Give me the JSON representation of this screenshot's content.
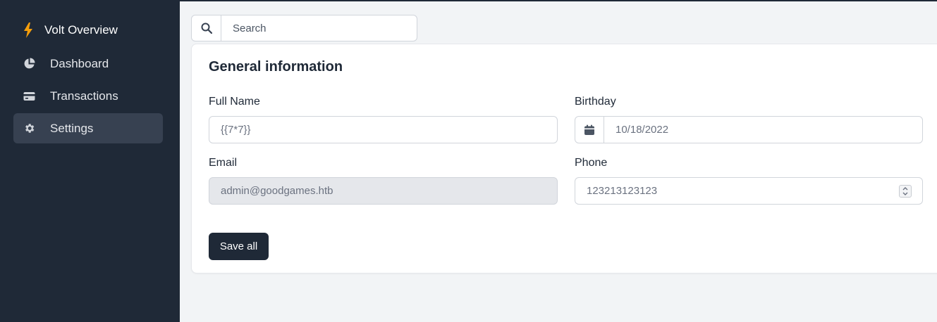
{
  "sidebar": {
    "brand": "Volt Overview",
    "items": [
      {
        "label": "Dashboard"
      },
      {
        "label": "Transactions"
      },
      {
        "label": "Settings"
      }
    ],
    "active": "Settings"
  },
  "search": {
    "placeholder": "Search"
  },
  "card": {
    "title": "General information",
    "full_name": {
      "label": "Full Name",
      "value": "{{7*7}}"
    },
    "birthday": {
      "label": "Birthday",
      "value": "10/18/2022"
    },
    "email": {
      "label": "Email",
      "value": "admin@goodgames.htb"
    },
    "phone": {
      "label": "Phone",
      "value": "123213123123"
    },
    "save_label": "Save all"
  },
  "colors": {
    "sidebar": "#1f2937",
    "brand_icon": "#f59e0b",
    "primary_button": "#1f2937"
  }
}
